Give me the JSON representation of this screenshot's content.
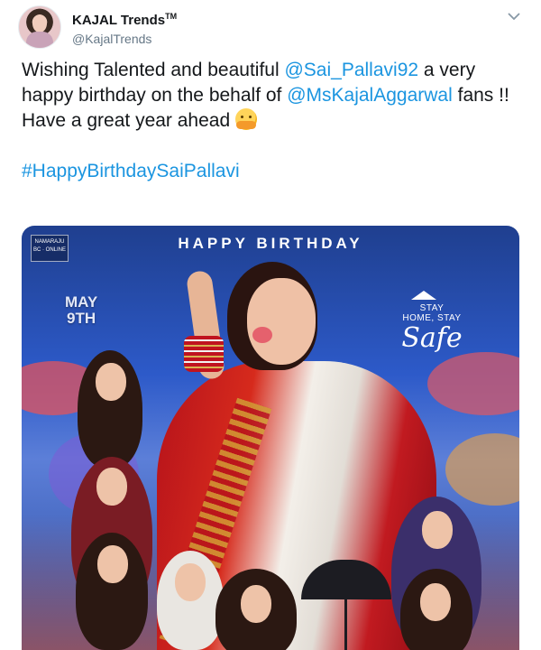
{
  "tweet": {
    "display_name": "KAJAL Trends",
    "display_name_mark": "TM",
    "handle": "@KajalTrends",
    "text": {
      "line1_before": "Wishing Talented and beautiful ",
      "mention1": "@Sai_Pallavi92",
      "line1_after": " a very happy birthday on the behalf of ",
      "mention2": "@MsKajalAggarwal",
      "line1_end": " fans !!",
      "line2": "Have a great year ahead ",
      "emoji": "hugging-face-emoji",
      "hashtag": "#HappyBirthdaySaiPallavi"
    },
    "poster": {
      "logo_text": "NAMARAJU BC · ONLINE",
      "title": "HAPPY BIRTHDAY",
      "date_month": "MAY",
      "date_day": "9TH",
      "stay_line1": "STAY",
      "stay_line2": "HOME, STAY",
      "safe": "Safe"
    }
  },
  "colors": {
    "link": "#1b95e0",
    "handle": "#657786",
    "text": "#14171a"
  },
  "icons": {
    "more_menu": "chevron-down-icon"
  }
}
